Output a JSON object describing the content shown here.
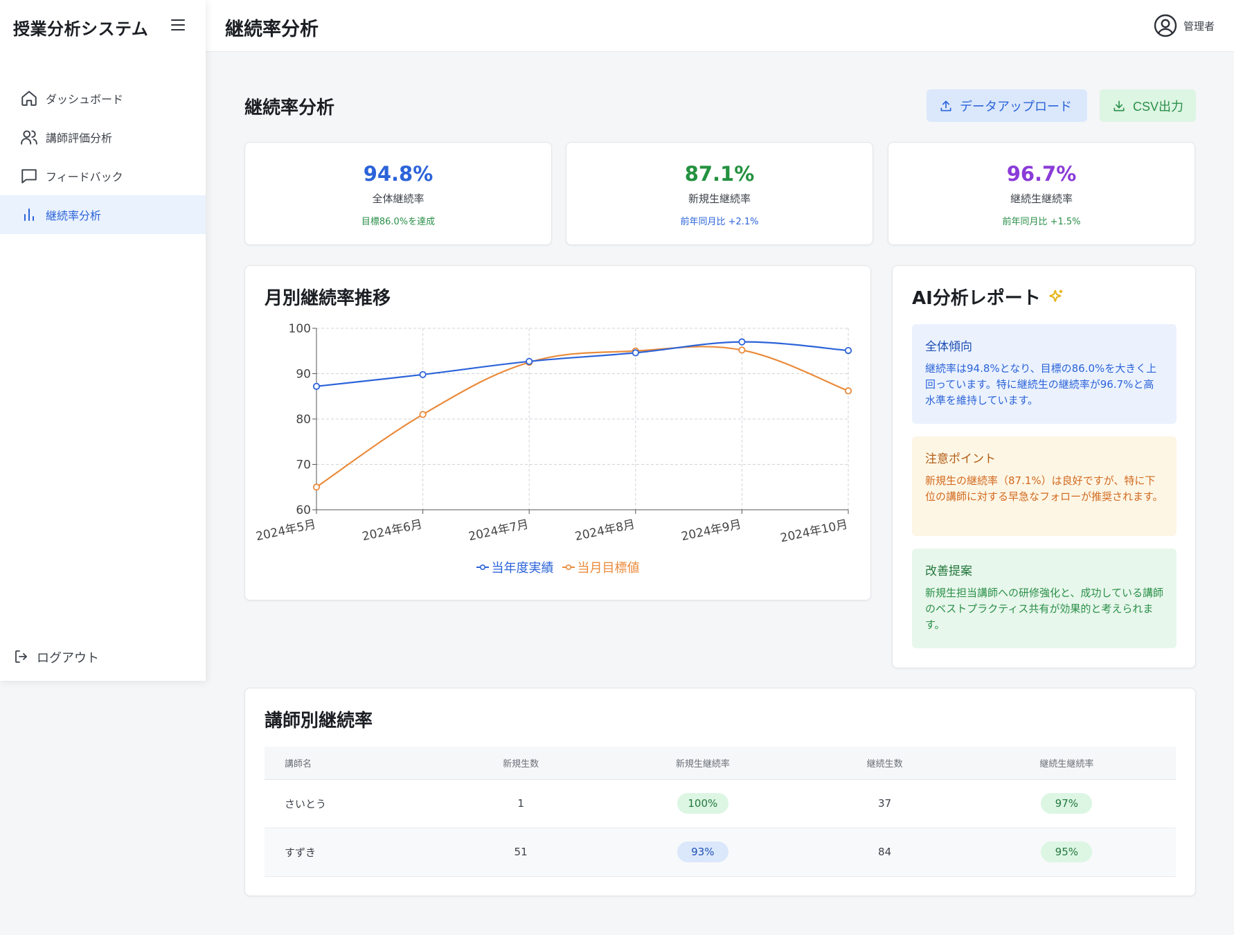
{
  "app": {
    "brand": "授業分析システム",
    "page_header": "継続率分析",
    "user_name": "管理者"
  },
  "sidebar": {
    "items": [
      {
        "label": "ダッシュボード",
        "icon": "home-icon"
      },
      {
        "label": "講師評価分析",
        "icon": "users-icon"
      },
      {
        "label": "フィードバック",
        "icon": "chat-icon"
      },
      {
        "label": "継続率分析",
        "icon": "bar-chart-icon",
        "active": true
      }
    ],
    "logout_label": "ログアウト"
  },
  "main": {
    "title": "継続率分析",
    "upload_label": "データアップロード",
    "csv_label": "CSV出力"
  },
  "stats": [
    {
      "value": "94.8%",
      "label": "全体継続率",
      "sub": "目標86.0%を達成",
      "color": "#2b63d9",
      "sub_color": "#2a8f48"
    },
    {
      "value": "87.1%",
      "label": "新規生継続率",
      "sub": "前年同月比 +2.1%",
      "color": "#23913f",
      "sub_color": "#2b63d9"
    },
    {
      "value": "96.7%",
      "label": "継続生継続率",
      "sub": "前年同月比 +1.5%",
      "color": "#8a3bd8",
      "sub_color": "#2a8f48"
    }
  ],
  "chart_title": "月別継続率推移",
  "chart_data": {
    "type": "line",
    "title": "月別継続率推移",
    "categories": [
      "2024年5月",
      "2024年6月",
      "2024年7月",
      "2024年8月",
      "2024年9月",
      "2024年10月"
    ],
    "ylim": [
      60,
      100
    ],
    "yticks": [
      60,
      70,
      80,
      90,
      100
    ],
    "grid": true,
    "legend": "bottom",
    "series": [
      {
        "name": "当年度実績",
        "color": "#2b63d9",
        "values": [
          87.2,
          89.8,
          92.7,
          94.6,
          97.0,
          95.1
        ]
      },
      {
        "name": "当月目標値",
        "color": "#ea8a3a",
        "values": [
          65.0,
          81.0,
          92.5,
          95.0,
          95.2,
          86.2
        ]
      }
    ]
  },
  "ai": {
    "title": "AI分析レポート",
    "blocks": [
      {
        "heading": "全体傾向",
        "text": "継続率は94.8%となり、目標の86.0%を大きく上回っています。特に継続生の継続率が96.7%と高水準を維持しています。"
      },
      {
        "heading": "注意ポイント",
        "text": "新規生の継続率（87.1%）は良好ですが、特に下位の講師に対する早急なフォローが推奨されます。"
      },
      {
        "heading": "改善提案",
        "text": "新規生担当講師への研修強化と、成功している講師のベストプラクティス共有が効果的と考えられます。"
      }
    ]
  },
  "table": {
    "title": "講師別継続率",
    "headers": [
      "講師名",
      "新規生数",
      "新規生継続率",
      "継続生数",
      "継続生継続率"
    ],
    "rows": [
      {
        "name": "さいとう",
        "new_count": "1",
        "new_rate": "100%",
        "cont_count": "37",
        "cont_rate": "97%"
      },
      {
        "name": "すずき",
        "new_count": "51",
        "new_rate": "93%",
        "cont_count": "84",
        "cont_rate": "95%"
      }
    ]
  }
}
